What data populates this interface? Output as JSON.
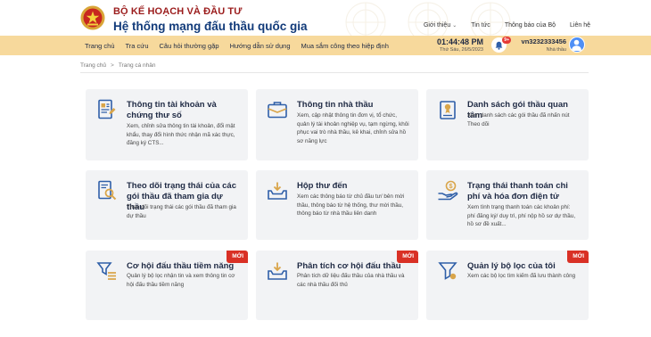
{
  "header": {
    "ministry": "BỘ KẾ HOẠCH VÀ ĐẦU TƯ",
    "system_name": "Hệ thống mạng đấu thầu quốc gia",
    "top_links": [
      "Giới thiệu",
      "Tin tức",
      "Thông báo của Bộ",
      "Liên hệ"
    ]
  },
  "nav": {
    "items": [
      "Trang chủ",
      "Tra cứu",
      "Câu hỏi thường gặp",
      "Hướng dẫn sử dụng",
      "Mua sắm công theo hiệp định"
    ],
    "time": "01:44:48 PM",
    "date": "Thứ Sáu, 26/5/2023",
    "notification_count": "9+",
    "username": "vn3232333456",
    "user_role": "Nhà thầu"
  },
  "breadcrumb": {
    "home": "Trang chủ",
    "separator": ">",
    "current": "Trang cá nhân"
  },
  "new_label": "MỚI",
  "cards": [
    {
      "title": "Thông tin tài khoản và chứng thư số",
      "desc": "Xem, chỉnh sửa thông tin tài khoản, đổi mật khẩu, thay đổi hình thức nhận mã xác thực, đăng ký CTS...",
      "icon": "account-document-icon",
      "is_new": false
    },
    {
      "title": "Thông tin nhà thầu",
      "desc": "Xem, cập nhật thông tin đơn vị, tổ chức, quản lý tài khoản nghiệp vụ, tạm ngừng, khôi phục vai trò nhà thầu, kê khai, chỉnh sửa hồ sơ năng lực",
      "icon": "briefcase-icon",
      "is_new": false
    },
    {
      "title": "Danh sách gói thầu quan tâm",
      "desc": "Xem danh sách các gói thầu đã nhấn nút Theo dõi",
      "icon": "package-list-icon",
      "is_new": false
    },
    {
      "title": "Theo dõi trạng thái của các gói thầu đã tham gia dự thầu",
      "desc": "Theo dõi trạng thái các gói thầu đã tham gia dự thầu",
      "icon": "document-search-icon",
      "is_new": false
    },
    {
      "title": "Hộp thư đến",
      "desc": "Xem các thông báo từ chủ đầu tư/ bên mời thầu, thông báo từ hệ thống, thư mời thầu, thông báo từ nhà thầu liên danh",
      "icon": "inbox-icon",
      "is_new": false
    },
    {
      "title": "Trạng thái thanh toán chi phí và hóa đơn điện tử",
      "desc": "Xem tình trạng thanh toán các khoản phí: phí đăng ký/ duy trì, phí nộp hồ sơ dự thầu, hồ sơ đề xuất...",
      "icon": "payment-hand-icon",
      "is_new": false
    },
    {
      "title": "Cơ hội đấu thầu tiềm năng",
      "desc": "Quản lý bộ lọc nhận tin và xem thông tin cơ hội đấu thầu tiềm năng",
      "icon": "funnel-list-icon",
      "is_new": true
    },
    {
      "title": "Phân tích cơ hội đấu thầu",
      "desc": "Phân tích dữ liệu đấu thầu của nhà thầu và các nhà thầu đối thủ",
      "icon": "analysis-inbox-icon",
      "is_new": true
    },
    {
      "title": "Quản lý bộ lọc của tôi",
      "desc": "Xem các bộ lọc tìm kiếm đã lưu thành công",
      "icon": "filter-manage-icon",
      "is_new": true
    }
  ],
  "colors": {
    "nav_bg": "#f7d99c",
    "ministry_red": "#9b1c1c",
    "brand_blue": "#123b7a",
    "icon_blue": "#2f5fa8",
    "icon_gold": "#d9a54a",
    "card_bg": "#f2f3f5",
    "new_badge": "#d93025"
  }
}
